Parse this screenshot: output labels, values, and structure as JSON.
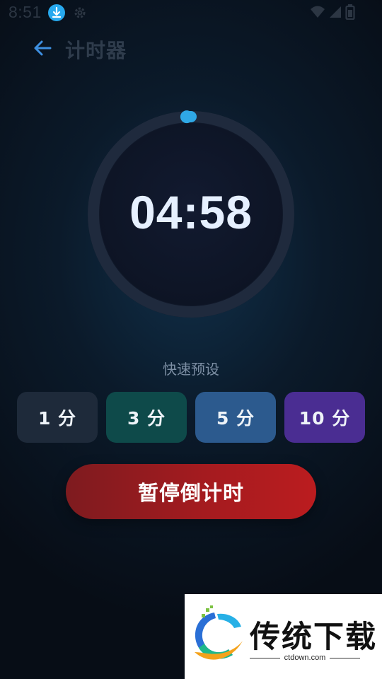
{
  "status_bar": {
    "time": "8:51",
    "icons": [
      "download-icon",
      "gear-icon",
      "wifi-icon",
      "signal-icon",
      "battery-icon"
    ]
  },
  "header": {
    "title": "计时器",
    "back_icon": "arrow-left-icon"
  },
  "timer": {
    "display": "04:58",
    "remaining_fraction": 0.993
  },
  "presets": {
    "label": "快速预设",
    "items": [
      {
        "label": "1 分",
        "color": "#1e2a3a"
      },
      {
        "label": "3 分",
        "color": "#0e4a4a"
      },
      {
        "label": "5 分",
        "color": "#2c5a8e"
      },
      {
        "label": "10 分",
        "color": "#4a2d92"
      }
    ]
  },
  "actions": {
    "pause_label": "暂停倒计时"
  },
  "watermark": {
    "brand": "传统下载",
    "url": "ctdown.com"
  },
  "colors": {
    "accent": "#2fa8e6",
    "pause": "#b01c20",
    "back_arrow": "#3d8fe0"
  }
}
